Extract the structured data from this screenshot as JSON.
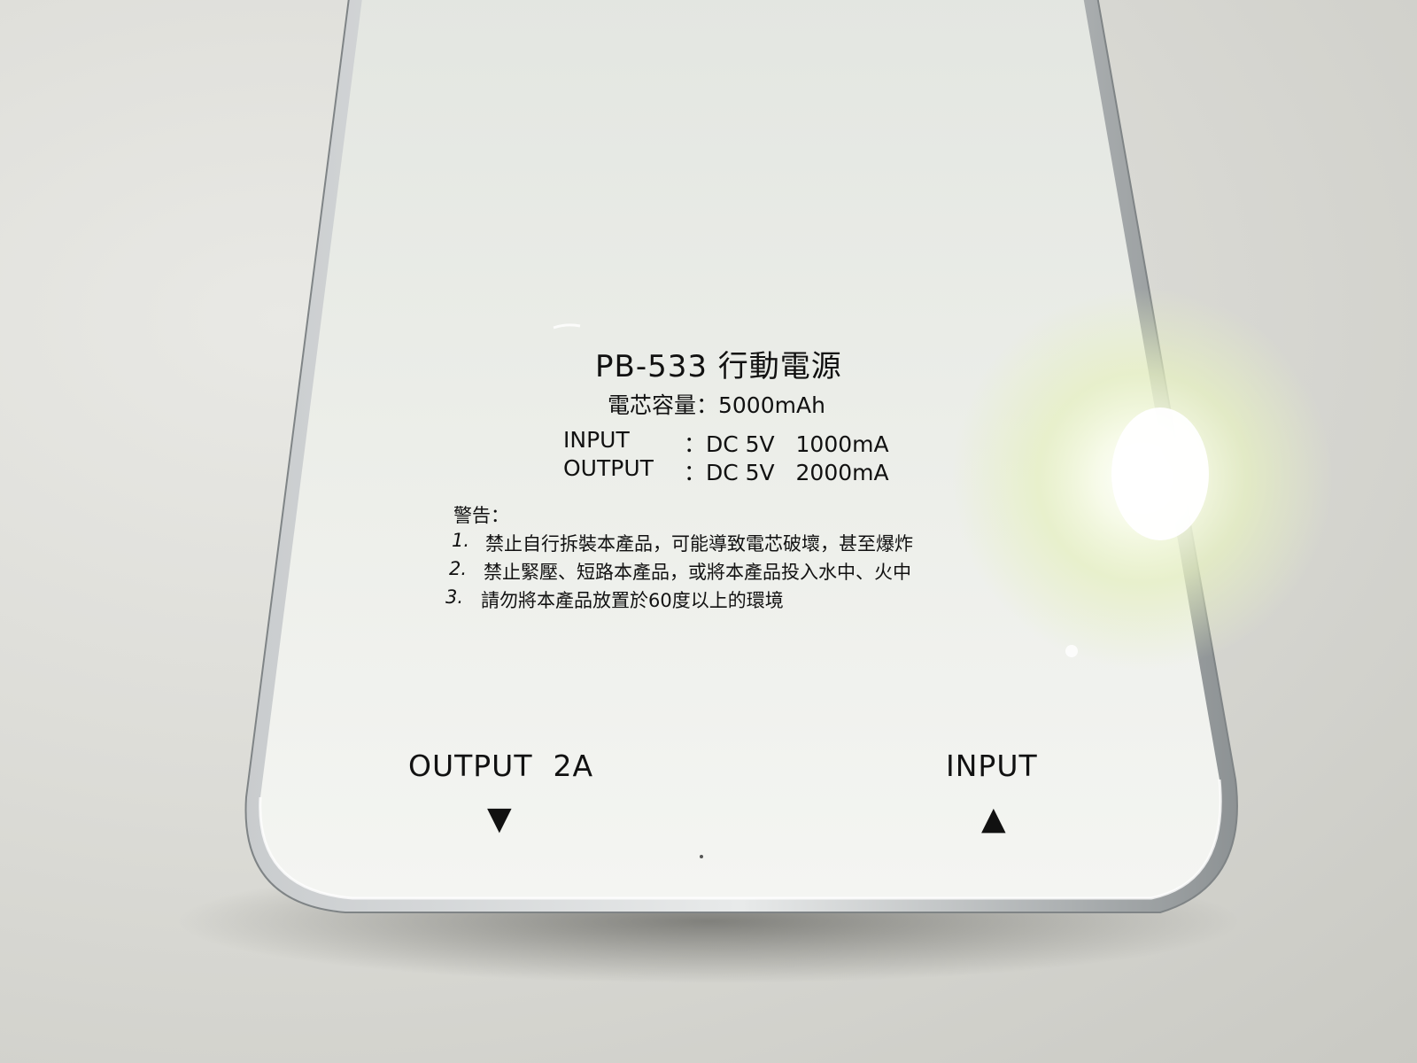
{
  "device": {
    "title": "PB-533 行動電源",
    "capacity": "電芯容量：5000mAh",
    "input_label": "INPUT",
    "input_value": "：DC 5V   1000mA",
    "output_label": "OUTPUT",
    "output_value": "：DC 5V   2000mA"
  },
  "warning": {
    "heading": "警告：",
    "items": [
      {
        "num": "1.",
        "text": "禁止自行拆裝本產品，可能導致電芯破壞，甚至爆炸"
      },
      {
        "num": "2.",
        "text": "禁止緊壓、短路本產品，或將本產品投入水中、火中"
      },
      {
        "num": "3.",
        "text": "請勿將本產品放置於60度以上的環境"
      }
    ]
  },
  "ports": {
    "output_label": "OUTPUT  2A",
    "output_arrow": "▼",
    "input_label": "INPUT",
    "input_arrow": "▲"
  },
  "colors": {
    "device_face": "#eef0ec",
    "device_edge": "#9a9ea0",
    "background": "#dcdcd7",
    "glare": "#eaf3c8",
    "text": "#111111"
  }
}
